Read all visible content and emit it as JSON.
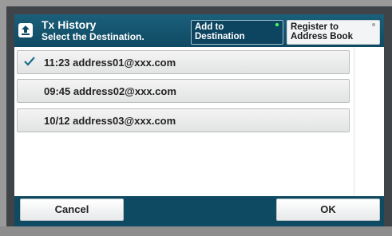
{
  "header": {
    "title": "Tx History",
    "subtitle": "Select the Destination.",
    "home_icon": "back-arrow-icon"
  },
  "tabs": [
    {
      "label_line1": "Add to",
      "label_line2": "Destination",
      "selected": true
    },
    {
      "label_line1": "Register to",
      "label_line2": "Address Book",
      "selected": false
    }
  ],
  "history": [
    {
      "time": "11:23",
      "address": "address01@xxx.com",
      "text": "11:23 address01@xxx.com",
      "checked": true
    },
    {
      "time": "09:45",
      "address": "address02@xxx.com",
      "text": "09:45 address02@xxx.com",
      "checked": false
    },
    {
      "time": "10/12",
      "address": "address03@xxx.com",
      "text": "10/12 address03@xxx.com",
      "checked": false
    }
  ],
  "footer": {
    "cancel_label": "Cancel",
    "ok_label": "OK"
  },
  "colors": {
    "header_bg": "#0f4a63",
    "check": "#1d6d8d",
    "indicator_on": "#45ff5a"
  }
}
